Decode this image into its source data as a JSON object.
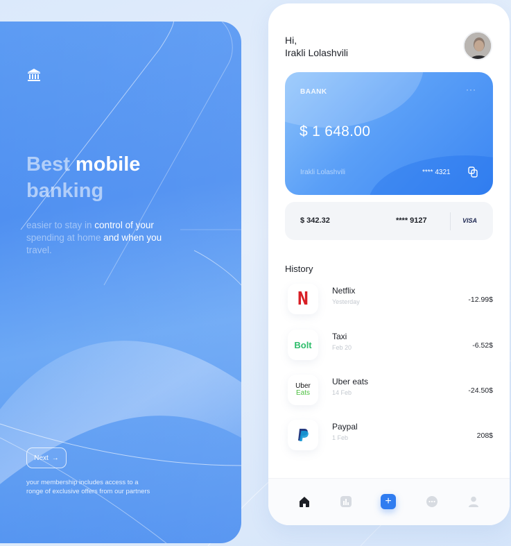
{
  "onboarding": {
    "headline_dim_1": "Best ",
    "headline_bright_1": "mobile",
    "headline_dim_2": "banking",
    "sub_dim_1": "easier to stay in ",
    "sub_bright_1": "control of your",
    "sub_dim_2": "spending at home ",
    "sub_bright_2": "and when you",
    "sub_dim_3": "travel.",
    "next_label": "Next",
    "next_arrow": "→",
    "membership_line_1": "your membership includes access to a",
    "membership_line_2": "ronge of exclusive offers from our partners"
  },
  "app": {
    "greeting": "Hi,",
    "user_name": "Irakli Lolashvili",
    "card": {
      "brand": "BAANK",
      "menu": "···",
      "balance": "$ 1 648.00",
      "holder": "Irakli Lolashvili",
      "number": "**** 4321"
    },
    "card2": {
      "amount": "$ 342.32",
      "number": "**** 9127",
      "network": "VISA"
    },
    "history_title": "History",
    "transactions": [
      {
        "name": "Netflix",
        "date": "Yesterday",
        "amount": "-12.99$",
        "logo_text": "N"
      },
      {
        "name": "Taxi",
        "date": "Feb 20",
        "amount": "-6.52$",
        "logo_text": "Bolt"
      },
      {
        "name": "Uber eats",
        "date": "14 Feb",
        "amount": "-24.50$",
        "logo_text_1": "Uber",
        "logo_text_2": "Eats"
      },
      {
        "name": "Paypal",
        "date": "1 Feb",
        "amount": "208$"
      }
    ],
    "tabbar": {
      "add_symbol": "+",
      "tabs": [
        "home-icon",
        "stats-icon",
        "add-icon",
        "chat-icon",
        "profile-icon"
      ]
    }
  },
  "colors": {
    "accent": "#2f7cf0",
    "panel_blue": "#4c8ef1",
    "netflix_red": "#d81f26",
    "bolt_green": "#2ebd6b"
  }
}
